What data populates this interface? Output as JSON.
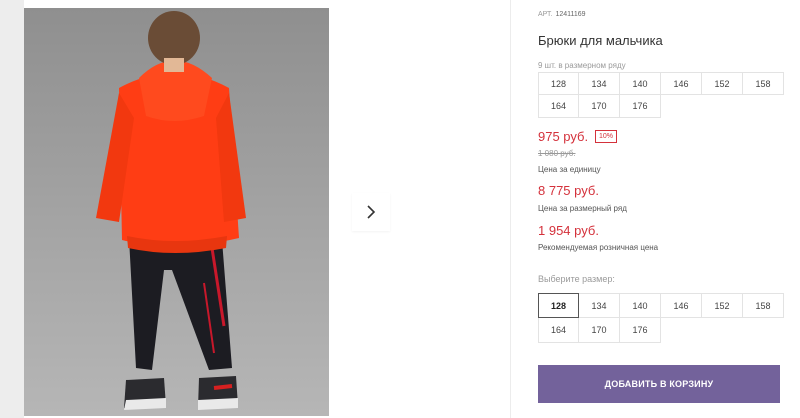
{
  "gallery": {
    "next_icon": "chevron-right-icon"
  },
  "product": {
    "art_label": "АРТ.",
    "art_number": "12411169",
    "title": "Брюки для мальчика",
    "series_note": "9 шт. в размерном ряду",
    "series_sizes": [
      "128",
      "134",
      "140",
      "146",
      "152",
      "158",
      "164",
      "170",
      "176"
    ]
  },
  "prices": {
    "unit_price": "975 руб.",
    "discount": "10%",
    "old_price": "1 080 руб.",
    "unit_caption": "Цена за единицу",
    "series_price": "8 775 руб.",
    "series_caption": "Цена за размерный ряд",
    "rrp_price": "1 954 руб.",
    "rrp_caption": "Рекомендуемая розничная цена"
  },
  "size_picker": {
    "label": "Выберите размер:",
    "selected": "128",
    "options": [
      "128",
      "134",
      "140",
      "146",
      "152",
      "158",
      "164",
      "170",
      "176"
    ]
  },
  "actions": {
    "add_to_cart": "ДОБАВИТЬ В КОРЗИНУ"
  },
  "colors": {
    "accent": "#73629b",
    "price": "#d4313b",
    "hoodie": "#ff3d14"
  }
}
